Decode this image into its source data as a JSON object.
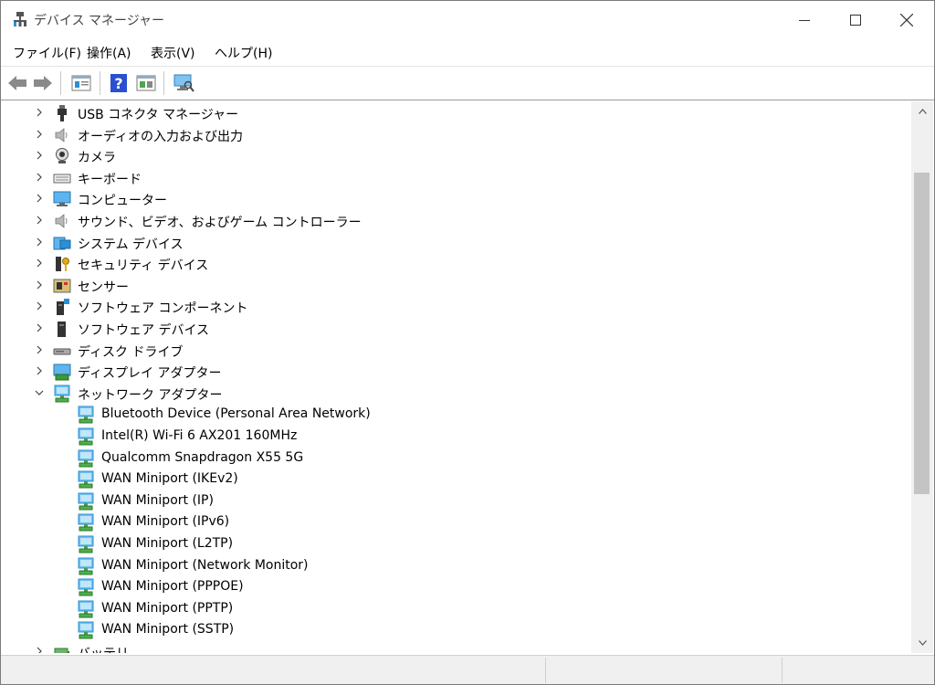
{
  "window": {
    "title": "デバイス マネージャー",
    "controls": [
      "minimize-icon",
      "maximize-icon",
      "close-icon"
    ]
  },
  "menu": [
    {
      "label": "ファイル(F)"
    },
    {
      "label": "操作(A)"
    },
    {
      "label": "表示(V)"
    },
    {
      "label": "ヘルプ(H)"
    }
  ],
  "toolbar": [
    "back-arrow-icon",
    "forward-arrow-icon",
    "properties-icon",
    "help-icon",
    "update-driver-icon",
    "scan-hardware-icon"
  ],
  "tree": [
    {
      "label": "USB コネクタ マネージャー",
      "icon": "usb-icon",
      "level": 0,
      "expanded": false
    },
    {
      "label": "オーディオの入力および出力",
      "icon": "speaker-icon",
      "level": 0,
      "expanded": false
    },
    {
      "label": "カメラ",
      "icon": "webcam-icon",
      "level": 0,
      "expanded": false
    },
    {
      "label": "キーボード",
      "icon": "keyboard-icon",
      "level": 0,
      "expanded": false
    },
    {
      "label": "コンピューター",
      "icon": "monitor-icon",
      "level": 0,
      "expanded": false
    },
    {
      "label": "サウンド、ビデオ、およびゲーム コントローラー",
      "icon": "speaker-icon",
      "level": 0,
      "expanded": false
    },
    {
      "label": "システム デバイス",
      "icon": "system-folder-icon",
      "level": 0,
      "expanded": false
    },
    {
      "label": "セキュリティ デバイス",
      "icon": "security-key-icon",
      "level": 0,
      "expanded": false
    },
    {
      "label": "センサー",
      "icon": "sensor-icon",
      "level": 0,
      "expanded": false
    },
    {
      "label": "ソフトウェア コンポーネント",
      "icon": "software-component-icon",
      "level": 0,
      "expanded": false
    },
    {
      "label": "ソフトウェア デバイス",
      "icon": "software-device-icon",
      "level": 0,
      "expanded": false
    },
    {
      "label": "ディスク ドライブ",
      "icon": "disk-drive-icon",
      "level": 0,
      "expanded": false
    },
    {
      "label": "ディスプレイ アダプター",
      "icon": "display-adapter-icon",
      "level": 0,
      "expanded": false
    },
    {
      "label": "ネットワーク アダプター",
      "icon": "network-adapter-icon",
      "level": 0,
      "expanded": true
    },
    {
      "label": "Bluetooth Device (Personal Area Network)",
      "icon": "network-adapter-icon",
      "level": 1
    },
    {
      "label": "Intel(R) Wi-Fi 6 AX201 160MHz",
      "icon": "network-adapter-icon",
      "level": 1
    },
    {
      "label": "Qualcomm Snapdragon X55 5G",
      "icon": "network-adapter-icon",
      "level": 1
    },
    {
      "label": "WAN Miniport (IKEv2)",
      "icon": "network-adapter-icon",
      "level": 1
    },
    {
      "label": "WAN Miniport (IP)",
      "icon": "network-adapter-icon",
      "level": 1
    },
    {
      "label": "WAN Miniport (IPv6)",
      "icon": "network-adapter-icon",
      "level": 1
    },
    {
      "label": "WAN Miniport (L2TP)",
      "icon": "network-adapter-icon",
      "level": 1
    },
    {
      "label": "WAN Miniport (Network Monitor)",
      "icon": "network-adapter-icon",
      "level": 1
    },
    {
      "label": "WAN Miniport (PPPOE)",
      "icon": "network-adapter-icon",
      "level": 1
    },
    {
      "label": "WAN Miniport (PPTP)",
      "icon": "network-adapter-icon",
      "level": 1
    },
    {
      "label": "WAN Miniport (SSTP)",
      "icon": "network-adapter-icon",
      "level": 1
    },
    {
      "label": "バッテリ",
      "icon": "battery-icon",
      "level": 0,
      "expanded": false
    }
  ],
  "colors": {
    "network_blue": "#2b8fd6",
    "scroll_thumb": "#c4c4c4",
    "status_bg": "#f0f0f0"
  }
}
